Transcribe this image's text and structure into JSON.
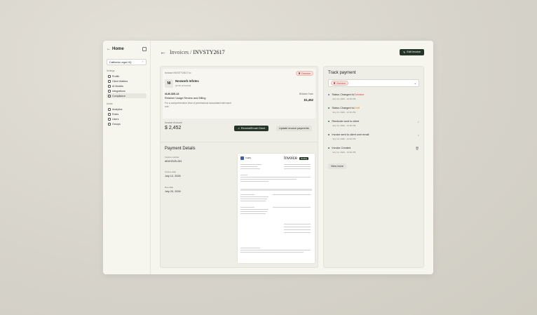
{
  "sidebar": {
    "home_label": "Home",
    "workspace": "California Legal HQ",
    "settings_label": "Settings",
    "settings_items": [
      {
        "label": "Profile",
        "icon": "user-icon"
      },
      {
        "label": "Client Matters",
        "icon": "briefcase-icon"
      },
      {
        "label": "AI Models",
        "icon": "chip-icon"
      },
      {
        "label": "Integrations",
        "icon": "plug-icon"
      },
      {
        "label": "Compliance",
        "icon": "shield-icon"
      }
    ],
    "admin_label": "Admin",
    "admin_items": [
      {
        "label": "Analytics",
        "icon": "chart-icon"
      },
      {
        "label": "Roles",
        "icon": "key-icon"
      },
      {
        "label": "Users",
        "icon": "users-icon"
      },
      {
        "label": "Groups",
        "icon": "group-icon"
      }
    ]
  },
  "header": {
    "crumb": "Invoices /",
    "invoice_id": "INVSTY2617",
    "edit_label": "Edit Invoice"
  },
  "invoice": {
    "to_label": "Invoice INVSTY2617 to",
    "status": "Overdue",
    "client_initials": "NI",
    "client_name": "Nexwork Infotec",
    "client_sub": "[email protected]",
    "item_id": "#LM-320.12",
    "item_title": "Retainer Usage Review and Billing",
    "item_desc": "For a comprehensive view of permissions associated with each role",
    "billable_label": "Billable Rate",
    "billable_value": "$1,452",
    "amount_label": "Invoice Amount",
    "amount_value": "$ 2,452",
    "remind_label": "Remind/Email Client",
    "update_label": "Update invoice payments"
  },
  "payment": {
    "title": "Payment Details",
    "number_label": "Invoice number",
    "number_value": "#INV2025-281",
    "date_label": "Invoice date",
    "date_value": "July 12, 2026",
    "due_label": "Due date",
    "due_value": "July 20, 2026"
  },
  "preview": {
    "brand": "Craftly",
    "title": "Invoice",
    "stamp": "Pending"
  },
  "track": {
    "title": "Track payment",
    "status": "Overdue",
    "events": [
      {
        "prefix": "Status Changed to ",
        "highlight": "Overdue",
        "time": "July 14, 2026 - 12:30 PM",
        "dot": "#4f7fd0",
        "icon": ""
      },
      {
        "prefix": "Status Changed to ",
        "highlight": "Draft",
        "time": "July 14, 2026 - 12:30 PM",
        "dot": "#2f7a4d",
        "icon": ""
      },
      {
        "prefix": "Reminder sent to client",
        "highlight": "",
        "time": "July 14, 2026 - 12:30 PM",
        "dot": "#2f7a4d",
        "icon": "bell-icon"
      },
      {
        "prefix": "Invoice sent to client over email",
        "highlight": "",
        "time": "July 14, 2026 - 12:30 PM",
        "dot": "#2f7a4d",
        "icon": "bell-icon"
      },
      {
        "prefix": "Invoice Created",
        "highlight": "",
        "time": "July 12, 2026 - 10:28 PM",
        "dot": "#2f7a4d",
        "icon": "trash-icon"
      }
    ],
    "view_more": "View more"
  },
  "colors": {
    "accent": "#253629",
    "overdue": "#c2493a",
    "draft": "#e08a32"
  }
}
